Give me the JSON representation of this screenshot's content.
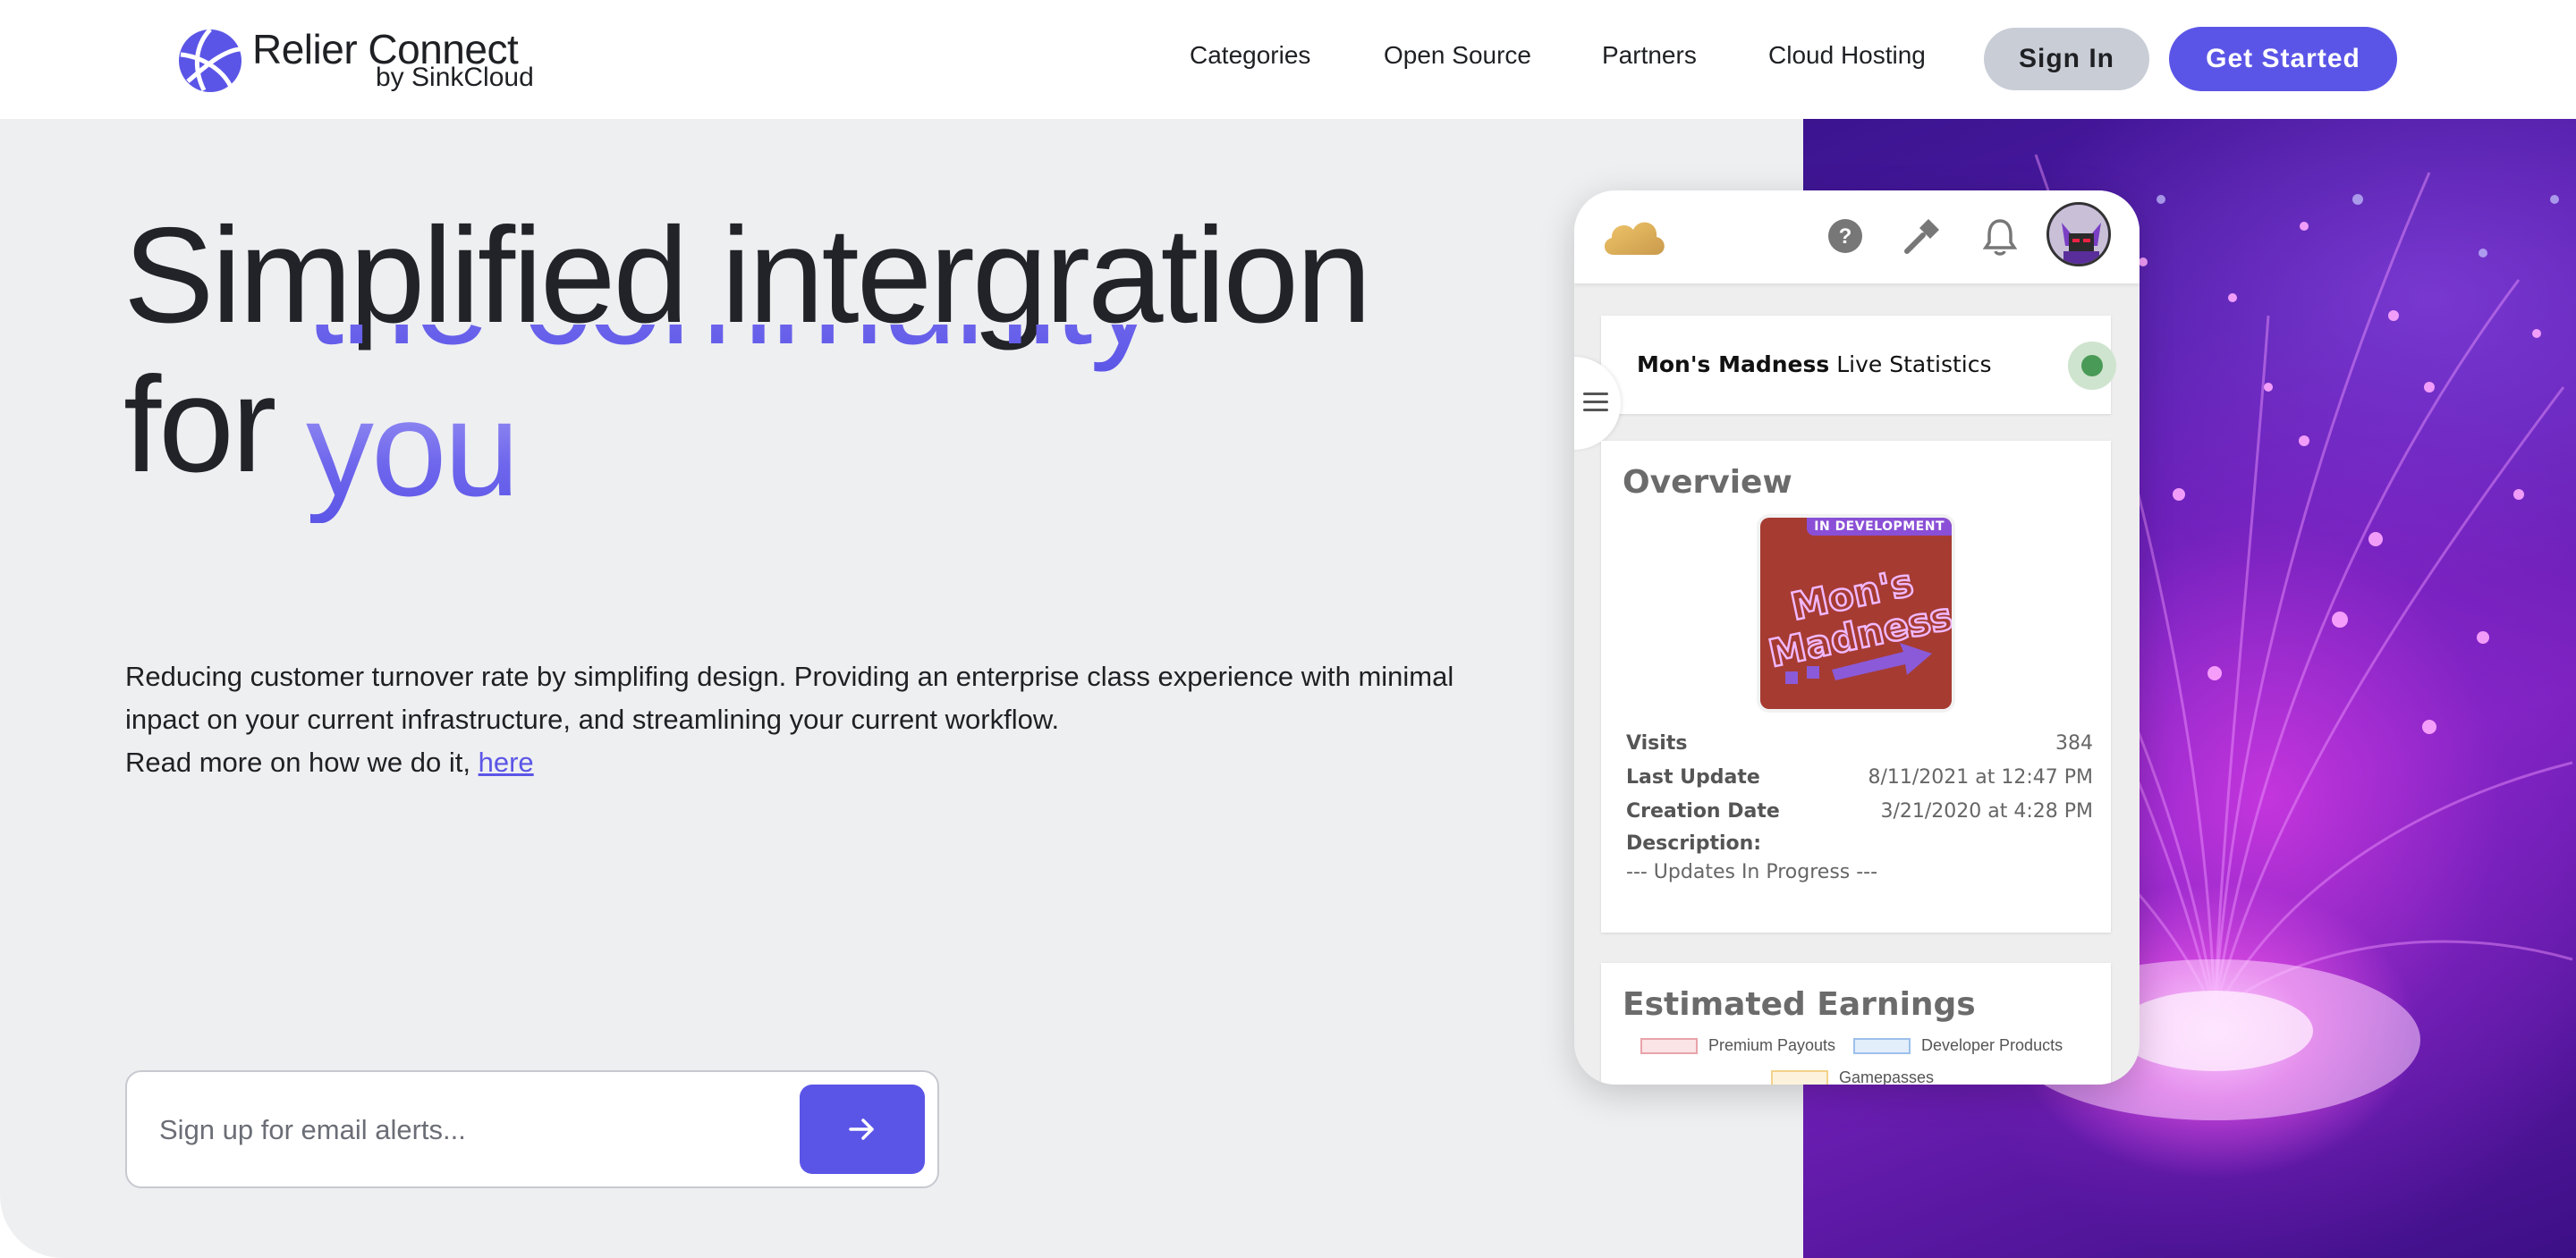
{
  "brand": {
    "name": "Relier Connect",
    "sub": "by SinkCloud"
  },
  "nav": {
    "links": [
      "Categories",
      "Open Source",
      "Partners",
      "Cloud Hosting"
    ],
    "signin_label": "Sign In",
    "getstarted_label": "Get Started"
  },
  "hero": {
    "title_line1": "Simplified intergration",
    "title_line2": "for",
    "rotating_words": [
      "the community",
      "you"
    ],
    "desc_line1": "Reducing customer turnover rate by simplifing design. Providing an enterprise class experience with minimal inpact on your current infrastructure, and streamlining your current workflow.",
    "desc_line2_prefix": "Read more on how we do it,",
    "desc_link": "here",
    "signup_placeholder": "Sign up for email alerts..."
  },
  "app_card": {
    "stats_title_bold": "Mon's Madness",
    "stats_title_rest": "Live Statistics",
    "overview_heading": "Overview",
    "thumb_badge": "IN DEVELOPMENT",
    "thumb_text_1": "Mon's",
    "thumb_text_2": "Madness",
    "rows": [
      {
        "key": "Visits",
        "value": "384"
      },
      {
        "key": "Last Update",
        "value": "8/11/2021 at 12:47 PM"
      },
      {
        "key": "Creation Date",
        "value": "3/21/2020 at 4:28 PM"
      }
    ],
    "description_key": "Description:",
    "description_value": "--- Updates In Progress ---",
    "earnings_heading": "Estimated Earnings",
    "legend": [
      {
        "name": "Premium Payouts",
        "color": "#e8a3aa"
      },
      {
        "name": "Developer Products",
        "color": "#9cc0ea"
      },
      {
        "name": "Gamepasses",
        "color": "#f2d28a"
      }
    ]
  },
  "colors": {
    "accent": "#5b55e7",
    "hero_bg": "#eeeff1"
  }
}
